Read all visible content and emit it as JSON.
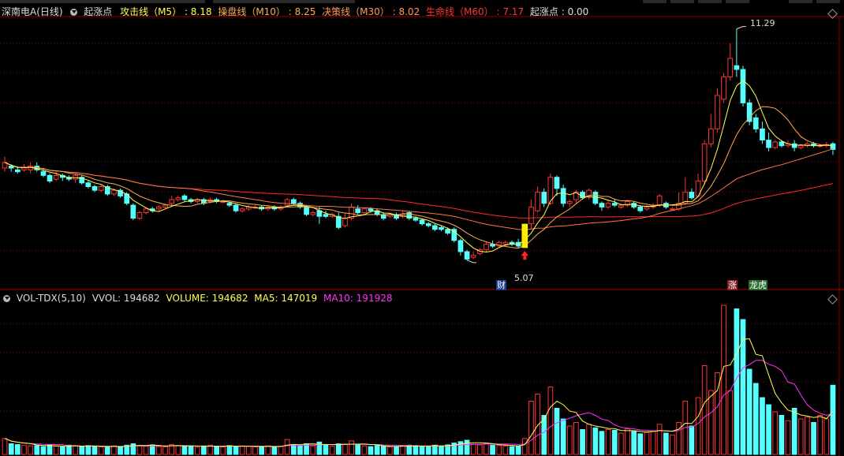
{
  "top_header": {
    "symbol": "深南电A(日线)",
    "indicator_name": "起涨点",
    "lines": [
      {
        "label": "攻击线（M5）",
        "value": ": 8.18",
        "color": "#ffff54"
      },
      {
        "label": "操盘线（M10）",
        "value": ": 8.25",
        "color": "#ffaa55"
      },
      {
        "label": "决策线（M30）",
        "value": ": 8.02",
        "color": "#ff9955"
      },
      {
        "label": "生命线（M60）",
        "value": ": 7.17",
        "color": "#ff3333"
      },
      {
        "label": "起涨点",
        "value": ": 0.00",
        "color": "#dddddd"
      }
    ]
  },
  "volume_header": {
    "indicator": "VOL-TDX(5,10)",
    "vvol": "VVOL: 194682",
    "volume": "VOLUME: 194682",
    "ma5": "MA5: 147019",
    "ma10": "MA10: 191928"
  },
  "annotations": {
    "high_label": "11.29",
    "low_label": "5.07",
    "badge_cai": "财",
    "badge_zhang": "涨",
    "badge_longhu": "龙虎"
  },
  "colors": {
    "up": "#ff3333",
    "down": "#54ffff",
    "ma5": "#ffff54",
    "ma10": "#ffaa55",
    "ma30": "#ff7744",
    "ma60": "#ff2a2a",
    "vol_ma10": "#ff33ff",
    "grid": "#8b0000"
  },
  "chart_data": {
    "type": "candlestick",
    "price_range": [
      4.6,
      11.6
    ],
    "candles": [
      [
        7.55,
        7.7,
        7.85,
        7.45
      ],
      [
        7.6,
        7.55,
        7.65,
        7.45
      ],
      [
        7.5,
        7.45,
        7.6,
        7.4
      ],
      [
        7.5,
        7.55,
        7.65,
        7.45
      ],
      [
        7.5,
        7.6,
        7.7,
        7.4
      ],
      [
        7.6,
        7.5,
        7.7,
        7.45
      ],
      [
        7.45,
        7.35,
        7.55,
        7.3
      ],
      [
        7.35,
        7.2,
        7.4,
        7.15
      ],
      [
        7.25,
        7.35,
        7.45,
        7.2
      ],
      [
        7.35,
        7.3,
        7.4,
        7.2
      ],
      [
        7.3,
        7.25,
        7.35,
        7.2
      ],
      [
        7.25,
        7.35,
        7.4,
        7.15
      ],
      [
        7.3,
        7.15,
        7.35,
        7.1
      ],
      [
        7.15,
        7.05,
        7.2,
        7.0
      ],
      [
        7.05,
        6.95,
        7.1,
        6.9
      ],
      [
        6.95,
        7.05,
        7.1,
        6.9
      ],
      [
        7.05,
        6.85,
        7.1,
        6.8
      ],
      [
        6.85,
        6.95,
        7.0,
        6.8
      ],
      [
        6.95,
        6.8,
        7.0,
        6.75
      ],
      [
        6.85,
        6.6,
        6.9,
        6.55
      ],
      [
        6.55,
        6.2,
        6.6,
        6.15
      ],
      [
        6.2,
        6.35,
        6.4,
        6.15
      ],
      [
        6.35,
        6.45,
        6.5,
        6.3
      ],
      [
        6.45,
        6.4,
        6.5,
        6.35
      ],
      [
        6.45,
        6.5,
        6.55,
        6.4
      ],
      [
        6.5,
        6.55,
        6.6,
        6.45
      ],
      [
        6.6,
        6.7,
        6.8,
        6.55
      ],
      [
        6.7,
        6.75,
        6.8,
        6.65
      ],
      [
        6.8,
        6.7,
        6.85,
        6.65
      ],
      [
        6.7,
        6.65,
        6.75,
        6.6
      ],
      [
        6.65,
        6.7,
        6.75,
        6.6
      ],
      [
        6.7,
        6.6,
        6.75,
        6.55
      ],
      [
        6.65,
        6.7,
        6.75,
        6.6
      ],
      [
        6.7,
        6.65,
        6.75,
        6.6
      ],
      [
        6.65,
        6.65,
        6.7,
        6.6
      ],
      [
        6.6,
        6.55,
        6.65,
        6.5
      ],
      [
        6.55,
        6.4,
        6.6,
        6.35
      ],
      [
        6.4,
        6.45,
        6.5,
        6.35
      ],
      [
        6.45,
        6.5,
        6.55,
        6.4
      ],
      [
        6.5,
        6.5,
        6.55,
        6.45
      ],
      [
        6.5,
        6.45,
        6.55,
        6.4
      ],
      [
        6.45,
        6.5,
        6.55,
        6.4
      ],
      [
        6.5,
        6.45,
        6.55,
        6.4
      ],
      [
        6.45,
        6.5,
        6.55,
        6.4
      ],
      [
        6.55,
        6.7,
        6.75,
        6.5
      ],
      [
        6.7,
        6.6,
        6.75,
        6.55
      ],
      [
        6.6,
        6.5,
        6.65,
        6.45
      ],
      [
        6.5,
        6.3,
        6.55,
        6.25
      ],
      [
        6.3,
        6.35,
        6.4,
        6.25
      ],
      [
        6.4,
        6.25,
        6.5,
        6.05
      ],
      [
        6.3,
        6.25,
        6.4,
        6.2
      ],
      [
        6.25,
        6.3,
        6.35,
        6.2
      ],
      [
        6.25,
        5.95,
        6.35,
        5.9
      ],
      [
        6.0,
        6.2,
        6.35,
        5.95
      ],
      [
        6.2,
        6.5,
        6.6,
        6.15
      ],
      [
        6.45,
        6.35,
        6.55,
        6.3
      ],
      [
        6.35,
        6.45,
        6.5,
        6.3
      ],
      [
        6.45,
        6.4,
        6.5,
        6.35
      ],
      [
        6.4,
        6.3,
        6.45,
        6.25
      ],
      [
        6.3,
        6.2,
        6.35,
        6.15
      ],
      [
        6.25,
        6.3,
        6.35,
        6.2
      ],
      [
        6.3,
        6.2,
        6.35,
        6.15
      ],
      [
        6.25,
        6.3,
        6.4,
        6.2
      ],
      [
        6.35,
        6.2,
        6.4,
        6.15
      ],
      [
        6.2,
        6.15,
        6.25,
        6.1
      ],
      [
        6.15,
        6.05,
        6.2,
        6.0
      ],
      [
        6.05,
        6.0,
        6.1,
        5.95
      ],
      [
        6.0,
        5.9,
        6.05,
        5.85
      ],
      [
        5.95,
        5.9,
        6.0,
        5.85
      ],
      [
        5.9,
        5.8,
        5.95,
        5.75
      ],
      [
        5.9,
        5.6,
        5.95,
        5.55
      ],
      [
        5.6,
        5.3,
        5.65,
        5.2
      ],
      [
        5.3,
        5.1,
        5.35,
        5.07
      ],
      [
        5.15,
        5.2,
        5.3,
        5.1
      ],
      [
        5.25,
        5.35,
        5.4,
        5.2
      ],
      [
        5.35,
        5.5,
        5.55,
        5.3
      ],
      [
        5.5,
        5.45,
        5.6,
        5.4
      ],
      [
        5.45,
        5.55,
        5.6,
        5.4
      ],
      [
        5.5,
        5.55,
        5.6,
        5.45
      ],
      [
        5.55,
        5.5,
        5.6,
        5.45
      ],
      [
        5.55,
        5.45,
        5.65,
        5.4
      ],
      [
        5.6,
        6.0,
        6.05,
        5.4
      ],
      [
        6.05,
        6.5,
        6.7,
        5.9
      ],
      [
        6.4,
        6.9,
        7.05,
        6.35
      ],
      [
        6.9,
        6.6,
        7.0,
        6.5
      ],
      [
        6.6,
        7.3,
        7.4,
        6.55
      ],
      [
        7.3,
        7.0,
        7.35,
        6.8
      ],
      [
        7.0,
        6.6,
        7.1,
        6.5
      ],
      [
        6.6,
        6.65,
        6.7,
        6.5
      ],
      [
        6.7,
        6.9,
        6.95,
        6.6
      ],
      [
        6.9,
        6.75,
        6.95,
        6.7
      ],
      [
        6.8,
        6.95,
        7.0,
        6.7
      ],
      [
        6.9,
        6.6,
        6.95,
        6.55
      ],
      [
        6.6,
        6.5,
        6.65,
        6.4
      ],
      [
        6.5,
        6.6,
        6.7,
        6.45
      ],
      [
        6.6,
        6.55,
        6.7,
        6.5
      ],
      [
        6.5,
        6.55,
        6.6,
        6.45
      ],
      [
        6.55,
        6.65,
        6.7,
        6.5
      ],
      [
        6.6,
        6.5,
        6.65,
        6.45
      ],
      [
        6.5,
        6.4,
        6.55,
        6.35
      ],
      [
        6.45,
        6.5,
        6.55,
        6.4
      ],
      [
        6.5,
        6.55,
        6.6,
        6.45
      ],
      [
        6.55,
        6.8,
        6.85,
        6.5
      ],
      [
        6.6,
        6.5,
        6.65,
        6.45
      ],
      [
        6.45,
        6.45,
        6.5,
        6.4
      ],
      [
        6.45,
        6.6,
        6.9,
        6.4
      ],
      [
        6.6,
        6.9,
        7.3,
        6.55
      ],
      [
        6.9,
        6.75,
        7.0,
        6.7
      ],
      [
        6.8,
        7.2,
        7.4,
        6.75
      ],
      [
        7.2,
        8.2,
        8.3,
        7.1
      ],
      [
        8.2,
        8.6,
        9.0,
        8.1
      ],
      [
        8.6,
        9.5,
        9.7,
        8.5
      ],
      [
        9.4,
        10.0,
        10.1,
        9.3
      ],
      [
        10.0,
        10.5,
        10.9,
        9.9
      ],
      [
        10.3,
        10.2,
        11.29,
        10.0
      ],
      [
        10.2,
        9.3,
        10.3,
        9.2
      ],
      [
        9.3,
        8.8,
        9.4,
        8.7
      ],
      [
        8.9,
        8.6,
        9.0,
        8.5
      ],
      [
        8.6,
        8.3,
        8.8,
        8.2
      ],
      [
        8.3,
        8.1,
        8.5,
        8.0
      ],
      [
        8.1,
        8.25,
        8.3,
        8.05
      ],
      [
        8.25,
        8.15,
        8.3,
        8.1
      ],
      [
        8.15,
        8.2,
        8.3,
        8.1
      ],
      [
        8.2,
        8.1,
        8.3,
        8.0
      ],
      [
        8.1,
        8.15,
        8.2,
        8.05
      ],
      [
        8.15,
        8.2,
        8.25,
        8.1
      ],
      [
        8.2,
        8.15,
        8.25,
        8.1
      ],
      [
        8.15,
        8.15,
        8.2,
        8.1
      ],
      [
        8.15,
        8.18,
        8.25,
        8.1
      ],
      [
        8.2,
        8.05,
        8.25,
        7.9
      ]
    ],
    "volume_range": [
      0,
      420000
    ],
    "volumes": [
      45000,
      30000,
      28000,
      26000,
      24000,
      25000,
      22000,
      27000,
      23000,
      21000,
      26000,
      24000,
      22000,
      25000,
      23000,
      21000,
      20000,
      24000,
      22000,
      26000,
      30000,
      25000,
      23000,
      27000,
      22000,
      21000,
      28000,
      25000,
      23000,
      22000,
      20000,
      24000,
      26000,
      23000,
      21000,
      25000,
      22000,
      24000,
      23000,
      21000,
      22000,
      24000,
      21000,
      23000,
      42000,
      28000,
      25000,
      30000,
      24000,
      35000,
      26000,
      23000,
      30000,
      28000,
      38000,
      27000,
      24000,
      22000,
      25000,
      23000,
      21000,
      22000,
      24000,
      26000,
      25000,
      23000,
      22000,
      26000,
      24000,
      27000,
      32000,
      36000,
      40000,
      28000,
      27000,
      30000,
      26000,
      25000,
      24000,
      22000,
      23000,
      45000,
      150000,
      170000,
      110000,
      190000,
      130000,
      100000,
      80000,
      90000,
      70000,
      85000,
      75000,
      65000,
      70000,
      68000,
      60000,
      72000,
      65000,
      58000,
      62000,
      66000,
      85000,
      60000,
      55000,
      90000,
      150000,
      80000,
      160000,
      250000,
      180000,
      230000,
      420000,
      180000,
      410000,
      380000,
      240000,
      200000,
      160000,
      140000,
      120000,
      110000,
      95000,
      130000,
      100000,
      105000,
      90000,
      110000,
      100000,
      195000
    ],
    "ma_volume": {
      "ma5_name": "MA5",
      "ma10_name": "MA10"
    }
  }
}
